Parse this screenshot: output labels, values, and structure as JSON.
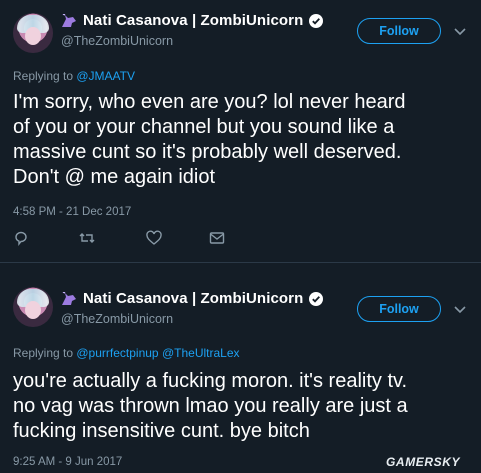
{
  "tweets": [
    {
      "display_name": "Nati Casanova | ZombiUnicorn",
      "handle": "@TheZombiUnicorn",
      "follow_label": "Follow",
      "replying_prefix": "Replying to ",
      "replying_to": [
        "@JMAATV"
      ],
      "text": "I'm sorry, who even are you? lol never heard\nof you or your channel but you sound like a\nmassive cunt so it's probably well deserved.\nDon't @ me again idiot",
      "timestamp": "4:58 PM - 21 Dec 2017"
    },
    {
      "display_name": "Nati Casanova | ZombiUnicorn",
      "handle": "@TheZombiUnicorn",
      "follow_label": "Follow",
      "replying_prefix": "Replying to ",
      "replying_to": [
        "@purrfectpinup",
        "@TheUltraLex"
      ],
      "text": "you're actually a fucking moron. it's reality tv.\nno vag was thrown lmao you really are just a\nfucking insensitive cunt. bye bitch",
      "timestamp": "9:25 AM - 9 Jun 2017"
    }
  ],
  "watermark": "GAMERSKY",
  "colors": {
    "background": "#141d26",
    "accent": "#1da1f2",
    "muted": "#8899a6"
  },
  "icons": [
    "unicorn-icon",
    "verified-icon",
    "chevron-down-icon",
    "reply-icon",
    "retweet-icon",
    "like-icon",
    "message-icon"
  ]
}
